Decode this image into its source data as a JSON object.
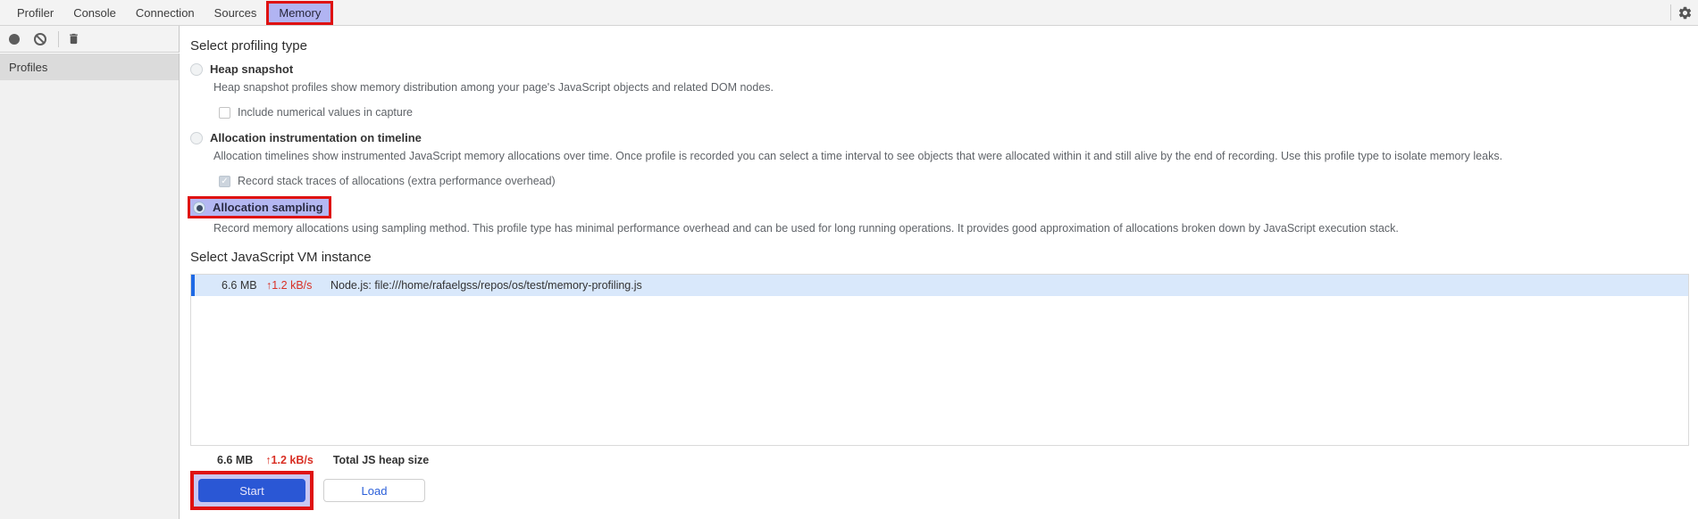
{
  "tabs": {
    "items": [
      {
        "label": "Profiler"
      },
      {
        "label": "Console"
      },
      {
        "label": "Connection"
      },
      {
        "label": "Sources"
      },
      {
        "label": "Memory"
      }
    ],
    "selected": "Memory"
  },
  "toolbar": {
    "icons": [
      "record-icon",
      "clear-icon",
      "delete-icon"
    ]
  },
  "header_icons": [
    "settings-gear-icon"
  ],
  "sidebar": {
    "items": [
      {
        "label": "Profiles",
        "selected": true
      }
    ]
  },
  "profiling": {
    "title": "Select profiling type",
    "options": [
      {
        "label": "Heap snapshot",
        "selected": false,
        "description": "Heap snapshot profiles show memory distribution among your page's JavaScript objects and related DOM nodes.",
        "sub_checkbox": {
          "label": "Include numerical values in capture",
          "checked": false
        }
      },
      {
        "label": "Allocation instrumentation on timeline",
        "selected": false,
        "description": "Allocation timelines show instrumented JavaScript memory allocations over time. Once profile is recorded you can select a time interval to see objects that were allocated within it and still alive by the end of recording. Use this profile type to isolate memory leaks.",
        "sub_checkbox": {
          "label": "Record stack traces of allocations (extra performance overhead)",
          "checked": true
        }
      },
      {
        "label": "Allocation sampling",
        "selected": true,
        "annotated": true,
        "description": "Record memory allocations using sampling method. This profile type has minimal performance overhead and can be used for long running operations. It provides good approximation of allocations broken down by JavaScript execution stack."
      }
    ]
  },
  "vm": {
    "title": "Select JavaScript VM instance",
    "instances": [
      {
        "size": "6.6 MB",
        "rate": "↑1.2 kB/s",
        "name": "Node.js: file:///home/rafaelgss/repos/os/test/memory-profiling.js",
        "selected": true
      }
    ]
  },
  "footer": {
    "heap_size": "6.6 MB",
    "heap_rate": "↑1.2 kB/s",
    "heap_label": "Total JS heap size",
    "start_label": "Start",
    "load_label": "Load"
  },
  "checkmark_glyph": "✓",
  "colors": {
    "annotation_red": "#df1212",
    "selected_tab_bg": "#b1b4f2",
    "start_button_blue": "#2a57d5",
    "load_text_blue": "#2b5fd9",
    "vm_row_bg": "#d9e8fb",
    "vm_row_accent": "#1f6ae5",
    "rate_red": "#d93025",
    "chrome_bg": "#f3f3f3"
  }
}
